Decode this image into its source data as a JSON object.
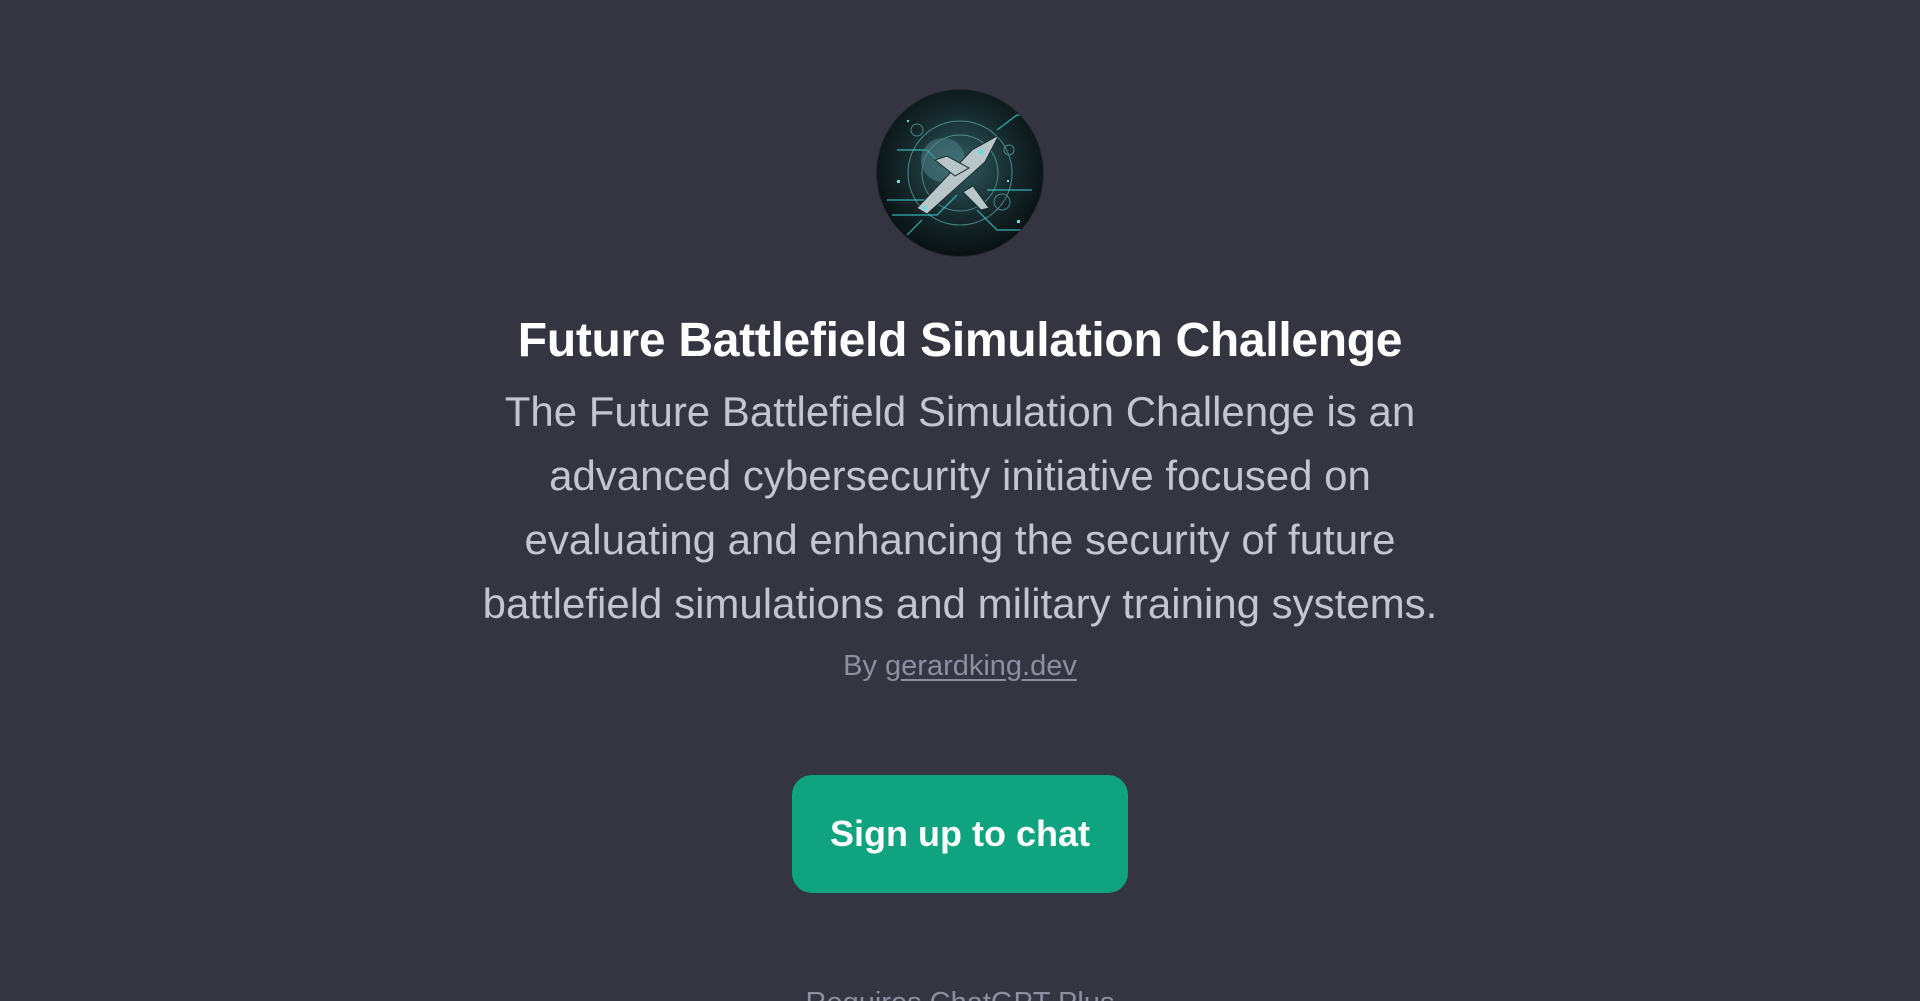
{
  "gpt": {
    "avatar_icon": "futuristic-aircraft-emblem-icon",
    "title": "Future Battlefield Simulation Challenge",
    "description": "The Future Battlefield Simulation Challenge is an advanced cybersecurity initiative focused on evaluating and enhancing the security of future battlefield simulations and military training systems.",
    "by_prefix": "By",
    "author": "gerardking.dev"
  },
  "actions": {
    "signup_label": "Sign up to chat"
  },
  "footer": {
    "note": "Requires ChatGPT Plus"
  },
  "colors": {
    "background": "#343541",
    "accent": "#10a37f",
    "title": "#ffffff",
    "body_text": "#c5c5d2",
    "muted_text": "#8e8ea0"
  }
}
